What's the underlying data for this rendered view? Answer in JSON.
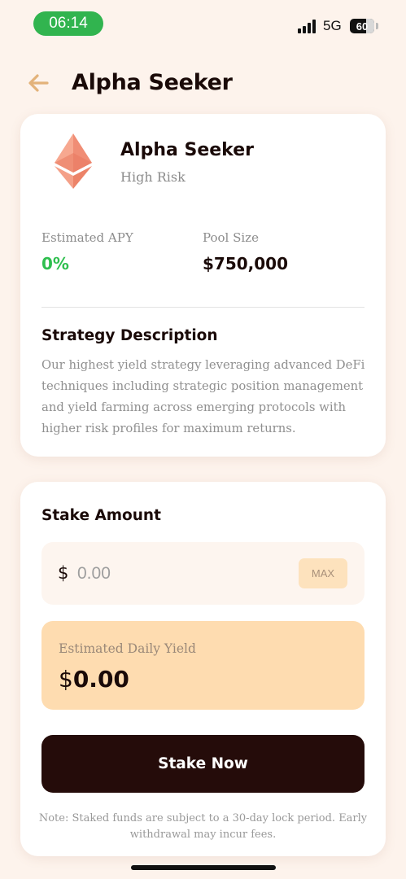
{
  "status_bar": {
    "time": "06:14",
    "network": "5G",
    "battery": "60",
    "colors": {
      "time_pill": "#31b44f"
    }
  },
  "header": {
    "back_icon": "arrow-left-icon",
    "title": "Alpha Seeker"
  },
  "pool": {
    "icon": "ethereum-icon",
    "name": "Alpha Seeker",
    "risk": "High Risk",
    "apy_label": "Estimated APY",
    "apy_value": "0%",
    "pool_size_label": "Pool Size",
    "pool_size_value": "$750,000",
    "description_title": "Strategy Description",
    "description": "Our highest yield strategy leveraging advanced DeFi techniques including strategic position management and yield farming across emerging protocols with higher risk profiles for maximum returns."
  },
  "stake": {
    "title": "Stake Amount",
    "currency_symbol": "$",
    "amount_placeholder": "0.00",
    "amount_value": "",
    "max_label": "MAX",
    "daily_yield_label": "Estimated Daily Yield",
    "daily_yield_currency": "$",
    "daily_yield_value": "0.00",
    "stake_button_label": "Stake Now",
    "note": "Note: Staked funds are subject to a 30-day lock period. Early withdrawal may incur fees."
  },
  "colors": {
    "background": "#fdf3ec",
    "accent_green": "#2fbf4f",
    "primary_button": "#250c0a",
    "yield_box": "#fedcb0",
    "back_arrow": "#e3b27a"
  }
}
